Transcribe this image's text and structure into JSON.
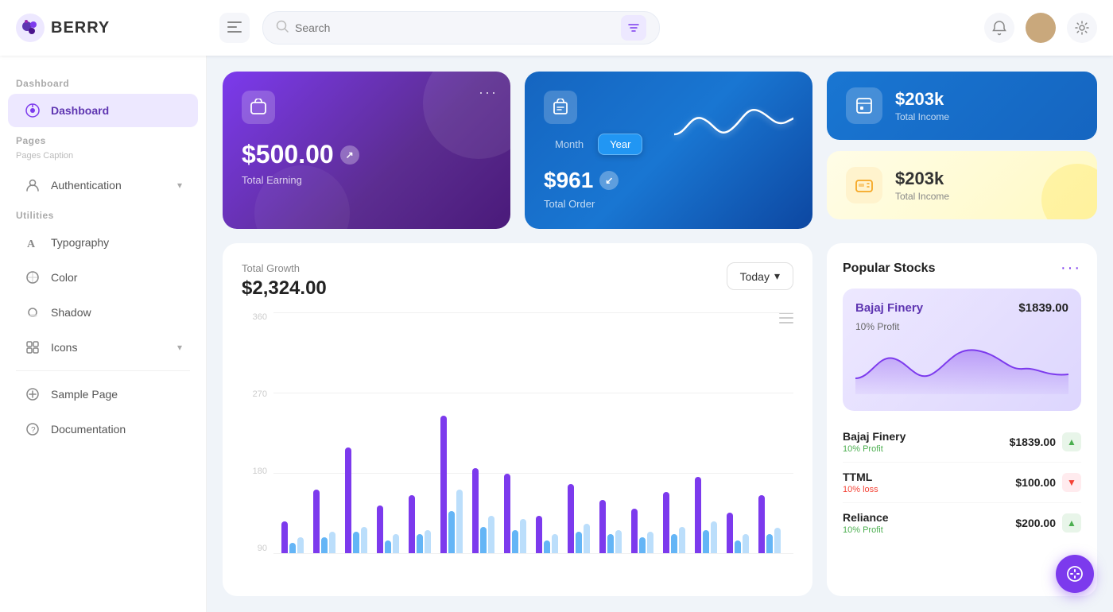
{
  "app": {
    "name": "BERRY",
    "logo": "🫐"
  },
  "header": {
    "search_placeholder": "Search",
    "menu_icon": "☰",
    "filter_icon": "⚙",
    "notification_icon": "🔔",
    "settings_icon": "⚙",
    "avatar_emoji": "👤"
  },
  "sidebar": {
    "dashboard_section": "Dashboard",
    "dashboard_item": "Dashboard",
    "pages_section": "Pages",
    "pages_caption": "Pages Caption",
    "authentication_label": "Authentication",
    "utilities_section": "Utilities",
    "typography_label": "Typography",
    "color_label": "Color",
    "shadow_label": "Shadow",
    "icons_label": "Icons",
    "sample_page_label": "Sample Page",
    "documentation_label": "Documentation"
  },
  "cards": {
    "earning": {
      "amount": "$500.00",
      "label": "Total Earning",
      "menu": "···"
    },
    "order": {
      "amount": "$961",
      "label": "Total Order",
      "toggle_month": "Month",
      "toggle_year": "Year"
    },
    "total_income_blue": {
      "amount": "$203k",
      "label": "Total Income"
    },
    "total_income_yellow": {
      "amount": "$203k",
      "label": "Total Income"
    }
  },
  "growth": {
    "title": "Total Growth",
    "amount": "$2,324.00",
    "button_label": "Today",
    "y_labels": [
      "360",
      "270",
      "180",
      "90"
    ],
    "menu": "≡",
    "bars": [
      {
        "purple": 30,
        "blue": 10,
        "light": 15
      },
      {
        "purple": 60,
        "blue": 15,
        "light": 20
      },
      {
        "purple": 100,
        "blue": 20,
        "light": 25
      },
      {
        "purple": 45,
        "blue": 12,
        "light": 18
      },
      {
        "purple": 55,
        "blue": 18,
        "light": 22
      },
      {
        "purple": 130,
        "blue": 40,
        "light": 60
      },
      {
        "purple": 80,
        "blue": 25,
        "light": 35
      },
      {
        "purple": 75,
        "blue": 22,
        "light": 32
      },
      {
        "purple": 35,
        "blue": 12,
        "light": 18
      },
      {
        "purple": 65,
        "blue": 20,
        "light": 28
      },
      {
        "purple": 50,
        "blue": 18,
        "light": 22
      },
      {
        "purple": 42,
        "blue": 15,
        "light": 20
      },
      {
        "purple": 58,
        "blue": 18,
        "light": 25
      },
      {
        "purple": 72,
        "blue": 22,
        "light": 30
      },
      {
        "purple": 38,
        "blue": 12,
        "light": 18
      },
      {
        "purple": 55,
        "blue": 18,
        "light": 24
      }
    ]
  },
  "stocks": {
    "title": "Popular Stocks",
    "more": "···",
    "featured": {
      "name": "Bajaj Finery",
      "price": "$1839.00",
      "profit": "10% Profit"
    },
    "list": [
      {
        "name": "Bajaj Finery",
        "price": "$1839.00",
        "change": "10% Profit",
        "trend": "up"
      },
      {
        "name": "TTML",
        "price": "$100.00",
        "change": "10% loss",
        "trend": "down"
      },
      {
        "name": "Reliance",
        "price": "$200.00",
        "change": "10% Profit",
        "trend": "up"
      }
    ]
  }
}
